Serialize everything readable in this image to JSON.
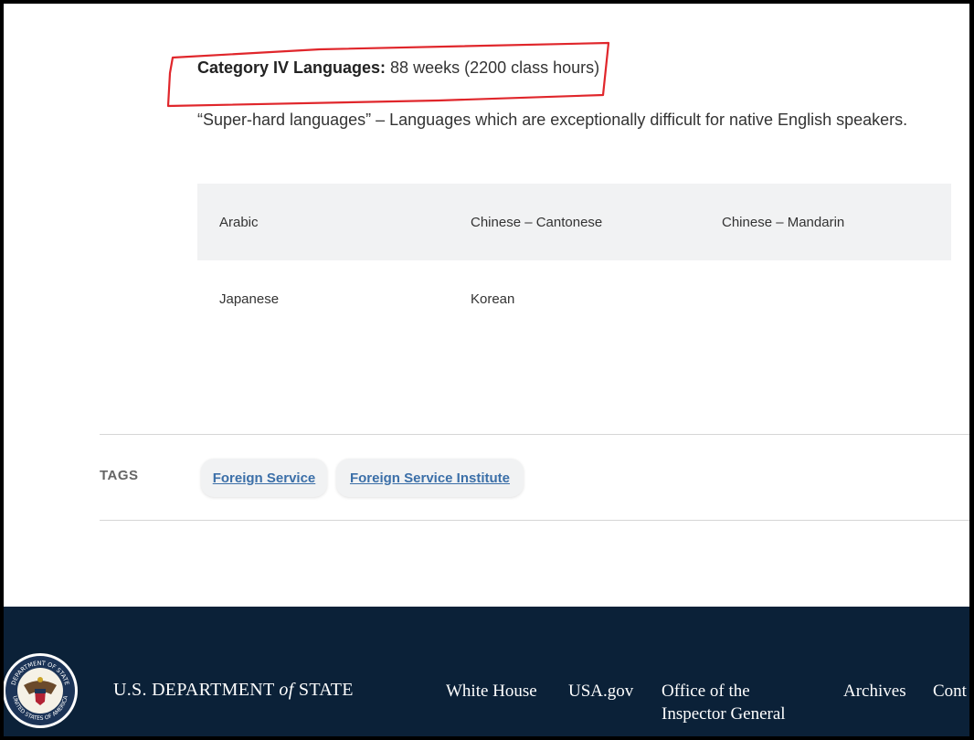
{
  "category": {
    "label": "Category IV Languages:",
    "duration": " 88 weeks (2200 class hours)",
    "description": "“Super-hard languages” – Languages which are exceptionally difficult for native English speakers."
  },
  "languages": [
    [
      "Arabic",
      "Chinese – Cantonese",
      "Chinese – Mandarin"
    ],
    [
      "Japanese",
      "Korean",
      ""
    ]
  ],
  "tags": {
    "label": "TAGS",
    "items": [
      "Foreign Service",
      "Foreign Service Institute"
    ]
  },
  "footer": {
    "brand_prefix": "U.S. DEPARTMENT ",
    "brand_of": "of",
    "brand_suffix": " STATE",
    "seal_text_top": "DEPARTMENT OF STATE",
    "seal_text_bottom": "UNITED STATES OF AMERICA",
    "links": [
      "White House",
      "USA.gov",
      "Office of the",
      "Inspector General",
      "Archives",
      "Cont"
    ]
  },
  "colors": {
    "annotation": "#e0262b",
    "footer_bg": "#0b2138",
    "tag_link": "#3b6fa8"
  }
}
